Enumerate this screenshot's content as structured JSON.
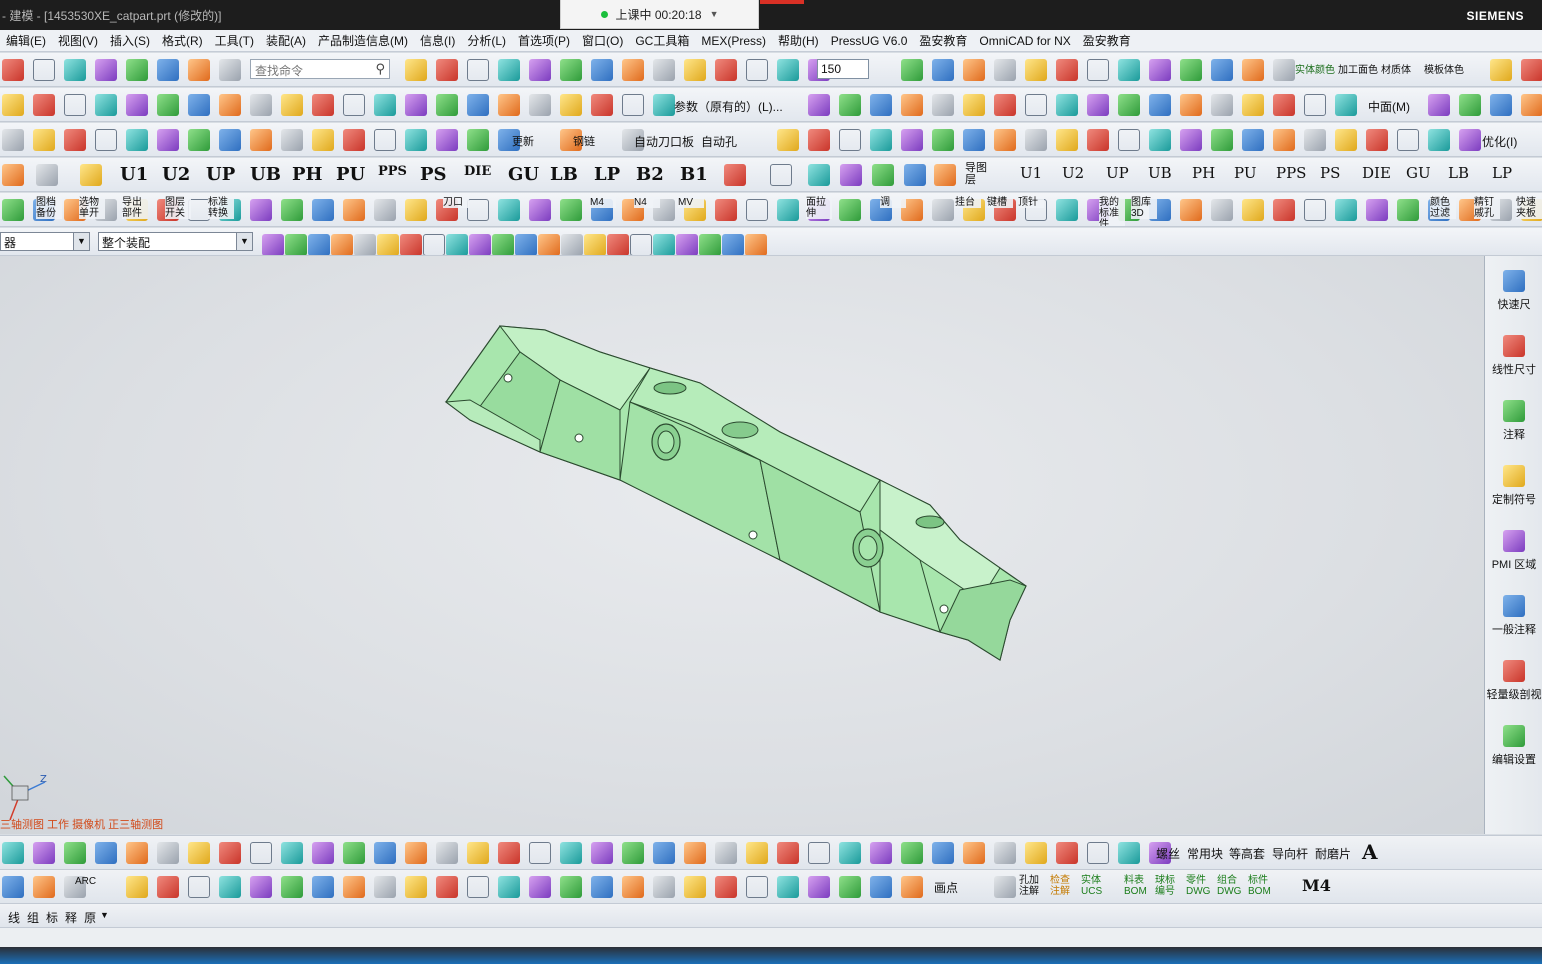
{
  "window": {
    "title": "- 建模 - [1453530XE_catpart.prt (修改的)]",
    "brand": "SIEMENS",
    "recording": "上课中 00:20:18"
  },
  "menu": [
    "编辑(E)",
    "视图(V)",
    "插入(S)",
    "格式(R)",
    "工具(T)",
    "装配(A)",
    "产品制造信息(M)",
    "信息(I)",
    "分析(L)",
    "首选项(P)",
    "窗口(O)",
    "GC工具箱",
    "MEX(Press)",
    "帮助(H)",
    "PressUG V6.0",
    "盈安教育",
    "OmniCAD for NX",
    "盈安教育"
  ],
  "toolbar1": {
    "search_placeholder": "查找命令",
    "zoom_value": "150",
    "labels": [
      "实体颜色",
      "加工面色",
      "材质体",
      "模板体色"
    ]
  },
  "toolbar2": {
    "labels": [
      "参数（原有的）(L)...",
      "中面(M)"
    ]
  },
  "toolbar3": {
    "labels": [
      "自动刀口板",
      "自动孔",
      "更新",
      "钢链",
      "优化(I)"
    ]
  },
  "toolbar4": {
    "items": [
      "U1",
      "U2",
      "UP",
      "UB",
      "PH",
      "PU",
      "PPS",
      "PS",
      "DIE",
      "GU",
      "LB",
      "LP",
      "B2",
      "B1"
    ],
    "items_small": [
      "U1",
      "U2",
      "UP",
      "UB",
      "PH",
      "PU",
      "PPS",
      "PS",
      "DIE",
      "GU",
      "LB",
      "LP"
    ],
    "extra": [
      "导图层"
    ]
  },
  "toolbar5": {
    "labels": [
      "图档备份",
      "选物单开",
      "导出部件",
      "图层开关",
      "标准转换",
      "刀口",
      "M4",
      "N4",
      "MV",
      "面拉伸",
      "调",
      "挂台",
      "键槽",
      "顶针",
      "我的标准件",
      "图库3D",
      "颜色过滤",
      "精钉戚孔",
      "快速夹板"
    ]
  },
  "selection": {
    "filter": "器",
    "scope": "整个装配"
  },
  "viewport": {
    "view_text": "三轴测图 工作 摄像机 正三轴测图"
  },
  "right_panel": [
    "快速尺",
    "线性尺寸",
    "注释",
    "定制符号",
    "PMI 区域",
    "一般注释",
    "轻量级剖视",
    "编辑设置"
  ],
  "bottom_toolbar": {
    "labels": [
      "螺丝",
      "常用块",
      "等高套",
      "导向杆",
      "耐磨片"
    ]
  },
  "bottom_toolbar2": {
    "labels": [
      "ARC",
      "画点",
      "孔加注解",
      "检查注解",
      "实体UCS",
      "料表BOM",
      "球标编号",
      "零件DWG",
      "组合DWG",
      "标件BOM",
      "M4"
    ]
  },
  "status": {
    "items": [
      "线",
      "组",
      "标",
      "释",
      "原"
    ]
  }
}
